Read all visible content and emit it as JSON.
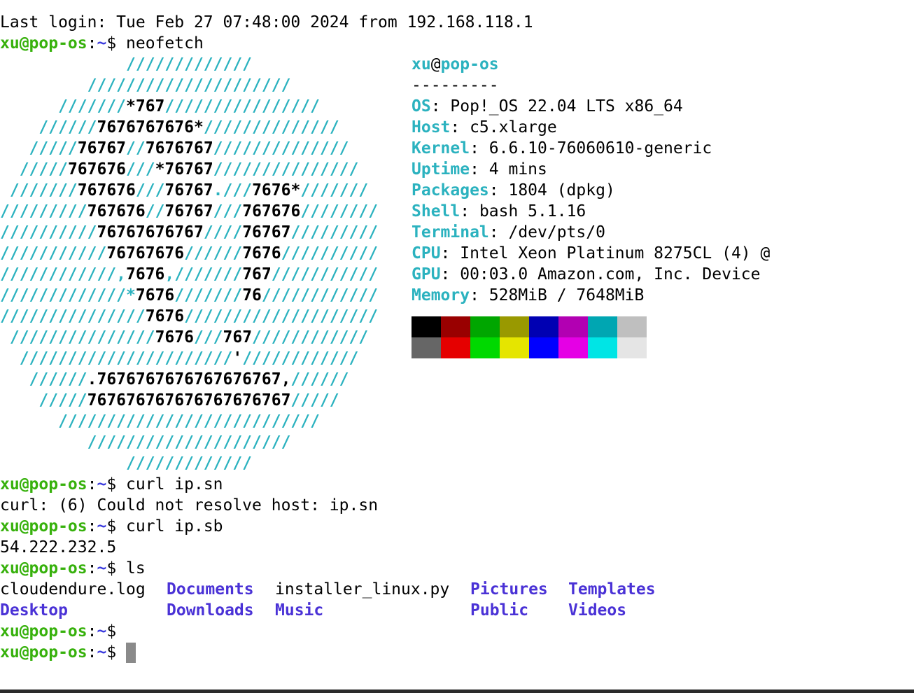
{
  "login_line": "Last login: Tue Feb 27 07:48:00 2024 from 192.168.118.1",
  "prompt": {
    "user_host": "xu@pop-os",
    "sep": ":",
    "path": "~",
    "dollar": "$ "
  },
  "commands": {
    "neofetch": "neofetch",
    "curl_sn": "curl ip.sn",
    "curl_sn_output": "curl: (6) Could not resolve host: ip.sn",
    "curl_sb": "curl ip.sb",
    "curl_sb_output": "54.222.232.5",
    "ls": "ls"
  },
  "neofetch": {
    "logo": [
      [
        [
          "s",
          "             /////////////"
        ]
      ],
      [
        [
          "s",
          "         /////////////////////"
        ]
      ],
      [
        [
          "s",
          "      ///////"
        ],
        [
          "n",
          "*767"
        ],
        [
          "s",
          "////////////////"
        ]
      ],
      [
        [
          "s",
          "    //////"
        ],
        [
          "n",
          "7676767676*"
        ],
        [
          "s",
          "//////////////"
        ]
      ],
      [
        [
          "s",
          "   /////"
        ],
        [
          "n",
          "76767"
        ],
        [
          "s",
          "//"
        ],
        [
          "n",
          "7676767"
        ],
        [
          "s",
          "//////////////"
        ]
      ],
      [
        [
          "s",
          "  /////"
        ],
        [
          "n",
          "767676"
        ],
        [
          "s",
          "///"
        ],
        [
          "n",
          "*76767"
        ],
        [
          "s",
          "///////////////"
        ]
      ],
      [
        [
          "s",
          " ///////"
        ],
        [
          "n",
          "767676"
        ],
        [
          "s",
          "///"
        ],
        [
          "n",
          "76767"
        ],
        [
          "s",
          ".///"
        ],
        [
          "n",
          "7676*"
        ],
        [
          "s",
          "///////"
        ]
      ],
      [
        [
          "s",
          "/////////"
        ],
        [
          "n",
          "767676"
        ],
        [
          "s",
          "//"
        ],
        [
          "n",
          "76767"
        ],
        [
          "s",
          "///"
        ],
        [
          "n",
          "767676"
        ],
        [
          "s",
          "////////"
        ]
      ],
      [
        [
          "s",
          "//////////"
        ],
        [
          "n",
          "76767676767"
        ],
        [
          "s",
          "////"
        ],
        [
          "n",
          "76767"
        ],
        [
          "s",
          "/////////"
        ]
      ],
      [
        [
          "s",
          "///////////"
        ],
        [
          "n",
          "76767676"
        ],
        [
          "s",
          "//////"
        ],
        [
          "n",
          "7676"
        ],
        [
          "s",
          "//////////"
        ]
      ],
      [
        [
          "s",
          "////////////,"
        ],
        [
          "n",
          "7676"
        ],
        [
          "s",
          ",///////"
        ],
        [
          "n",
          "767"
        ],
        [
          "s",
          "///////////"
        ]
      ],
      [
        [
          "s",
          "/////////////*"
        ],
        [
          "n",
          "7676"
        ],
        [
          "s",
          "///////"
        ],
        [
          "n",
          "76"
        ],
        [
          "s",
          "////////////"
        ]
      ],
      [
        [
          "s",
          "///////////////"
        ],
        [
          "n",
          "7676"
        ],
        [
          "s",
          "////////////////////"
        ]
      ],
      [
        [
          "s",
          " ///////////////"
        ],
        [
          "n",
          "7676"
        ],
        [
          "s",
          "///"
        ],
        [
          "n",
          "767"
        ],
        [
          "s",
          "////////////"
        ]
      ],
      [
        [
          "s",
          "  //////////////////////"
        ],
        [
          "n",
          "'"
        ],
        [
          "s",
          "////////////"
        ]
      ],
      [
        [
          "s",
          "   //////"
        ],
        [
          "n",
          ".7676767676767676767,"
        ],
        [
          "s",
          "//////"
        ]
      ],
      [
        [
          "s",
          "    /////"
        ],
        [
          "n",
          "767676767676767676767"
        ],
        [
          "s",
          "/////"
        ]
      ],
      [
        [
          "s",
          "      ///////////////////////////"
        ]
      ],
      [
        [
          "s",
          "         /////////////////////"
        ]
      ],
      [
        [
          "s",
          "             /////////////"
        ]
      ]
    ],
    "user": "xu",
    "at": "@",
    "host": "pop-os",
    "separator": "---------",
    "info": [
      {
        "key": "OS",
        "value": ": Pop!_OS 22.04 LTS x86_64"
      },
      {
        "key": "Host",
        "value": ": c5.xlarge"
      },
      {
        "key": "Kernel",
        "value": ": 6.6.10-76060610-generic"
      },
      {
        "key": "Uptime",
        "value": ": 4 mins"
      },
      {
        "key": "Packages",
        "value": ": 1804 (dpkg)"
      },
      {
        "key": "Shell",
        "value": ": bash 5.1.16"
      },
      {
        "key": "Terminal",
        "value": ": /dev/pts/0"
      },
      {
        "key": "CPU",
        "value": ": Intel Xeon Platinum 8275CL (4) @"
      },
      {
        "key": "GPU",
        "value": ": 00:03.0 Amazon.com, Inc. Device"
      },
      {
        "key": "Memory",
        "value": ": 528MiB / 7648MiB"
      }
    ],
    "palette": [
      "#000000",
      "#990000",
      "#00a600",
      "#999900",
      "#0000b2",
      "#b200b2",
      "#00a6b2",
      "#bfbfbf",
      "#666666",
      "#e50000",
      "#00d900",
      "#e5e500",
      "#0000ff",
      "#e500e5",
      "#00e5e5",
      "#e5e5e5"
    ]
  },
  "ls_output": {
    "row1": [
      {
        "name": "cloudendure.log",
        "type": "file"
      },
      {
        "name": "Documents",
        "type": "dir"
      },
      {
        "name": "installer_linux.py",
        "type": "file"
      },
      {
        "name": "Pictures",
        "type": "dir"
      },
      {
        "name": "Templates",
        "type": "dir"
      }
    ],
    "row2": [
      {
        "name": "Desktop",
        "type": "dir"
      },
      {
        "name": "Downloads",
        "type": "dir"
      },
      {
        "name": "Music",
        "type": "dir"
      },
      {
        "name": "Public",
        "type": "dir"
      },
      {
        "name": "Videos",
        "type": "dir"
      }
    ]
  },
  "colors": {
    "prompt_user": "#37b10c",
    "prompt_path": "#3c3cde",
    "accent_cyan": "#2bb2bf",
    "directory": "#4a32d6",
    "cursor": "#8a8a8a"
  }
}
